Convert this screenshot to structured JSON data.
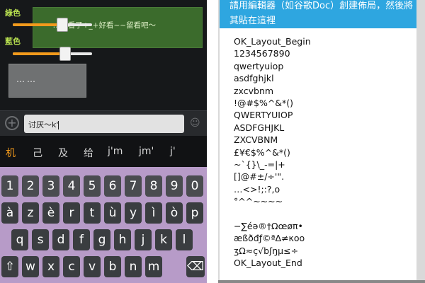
{
  "left_screen": {
    "sliders": [
      {
        "label": "綠色",
        "value_fraction": 0.62
      },
      {
        "label": "藍色",
        "value_fraction": 0.66
      }
    ],
    "bubble_green_text": "~~…好看了+_+好看~~留看吧～",
    "bubble_gray_text": "……",
    "input_text": "讨厌～k'",
    "add_icon_label": "+",
    "send_icon_label": "☺",
    "candidates": [
      "机",
      "己",
      "及",
      "给",
      "j'm",
      "jm'",
      "j'"
    ],
    "number_row": [
      "1",
      "2",
      "3",
      "4",
      "5",
      "6",
      "7",
      "8",
      "9",
      "0"
    ],
    "row_1": [
      "q",
      "w",
      "e",
      "r",
      "t",
      "y",
      "u",
      "i",
      "o",
      "p"
    ],
    "row_2": [
      "à",
      "z",
      "è",
      "r",
      "t",
      "ù",
      "y",
      "ì",
      "ò",
      "p"
    ],
    "row_3": [
      "q",
      "s",
      "d",
      "f",
      "g",
      "h",
      "j",
      "k",
      "l"
    ],
    "row_4": [
      "w",
      "x",
      "c",
      "v",
      "b",
      "n",
      "m"
    ],
    "delete_key": "⌫",
    "colors": {
      "accent_orange": "#f29a1c",
      "bubble_green": "#3b6b2c",
      "keyboard_bg": "#b79bc8"
    }
  },
  "right_screen": {
    "dialog_title": "請用編輯器（如谷歌Doc）創建佈局，然後將其貼在這裡",
    "layout_lines": [
      "OK_Layout_Begin",
      "1234567890",
      "qwertyuiop",
      "asdfghjkl",
      "zxcvbnm",
      "!@#$%^&*()",
      "QWERTYUIOP",
      "ASDFGHJKL",
      "ZXCVBNM",
      "£¥€$%^&*()",
      "~`{}\\_-=|+",
      "[]@#±/÷'\".",
      "…<>!;:?,o",
      "°^^~~~~",
      "",
      "−∑éə®†Ωœøπ•",
      "æßðđƒ©ªΔ≠κoo",
      "ʒΩ≈ç√bʃŋµ≤÷",
      "OK_Layout_End"
    ],
    "colors": {
      "header_blue": "#2ea6e0"
    }
  }
}
